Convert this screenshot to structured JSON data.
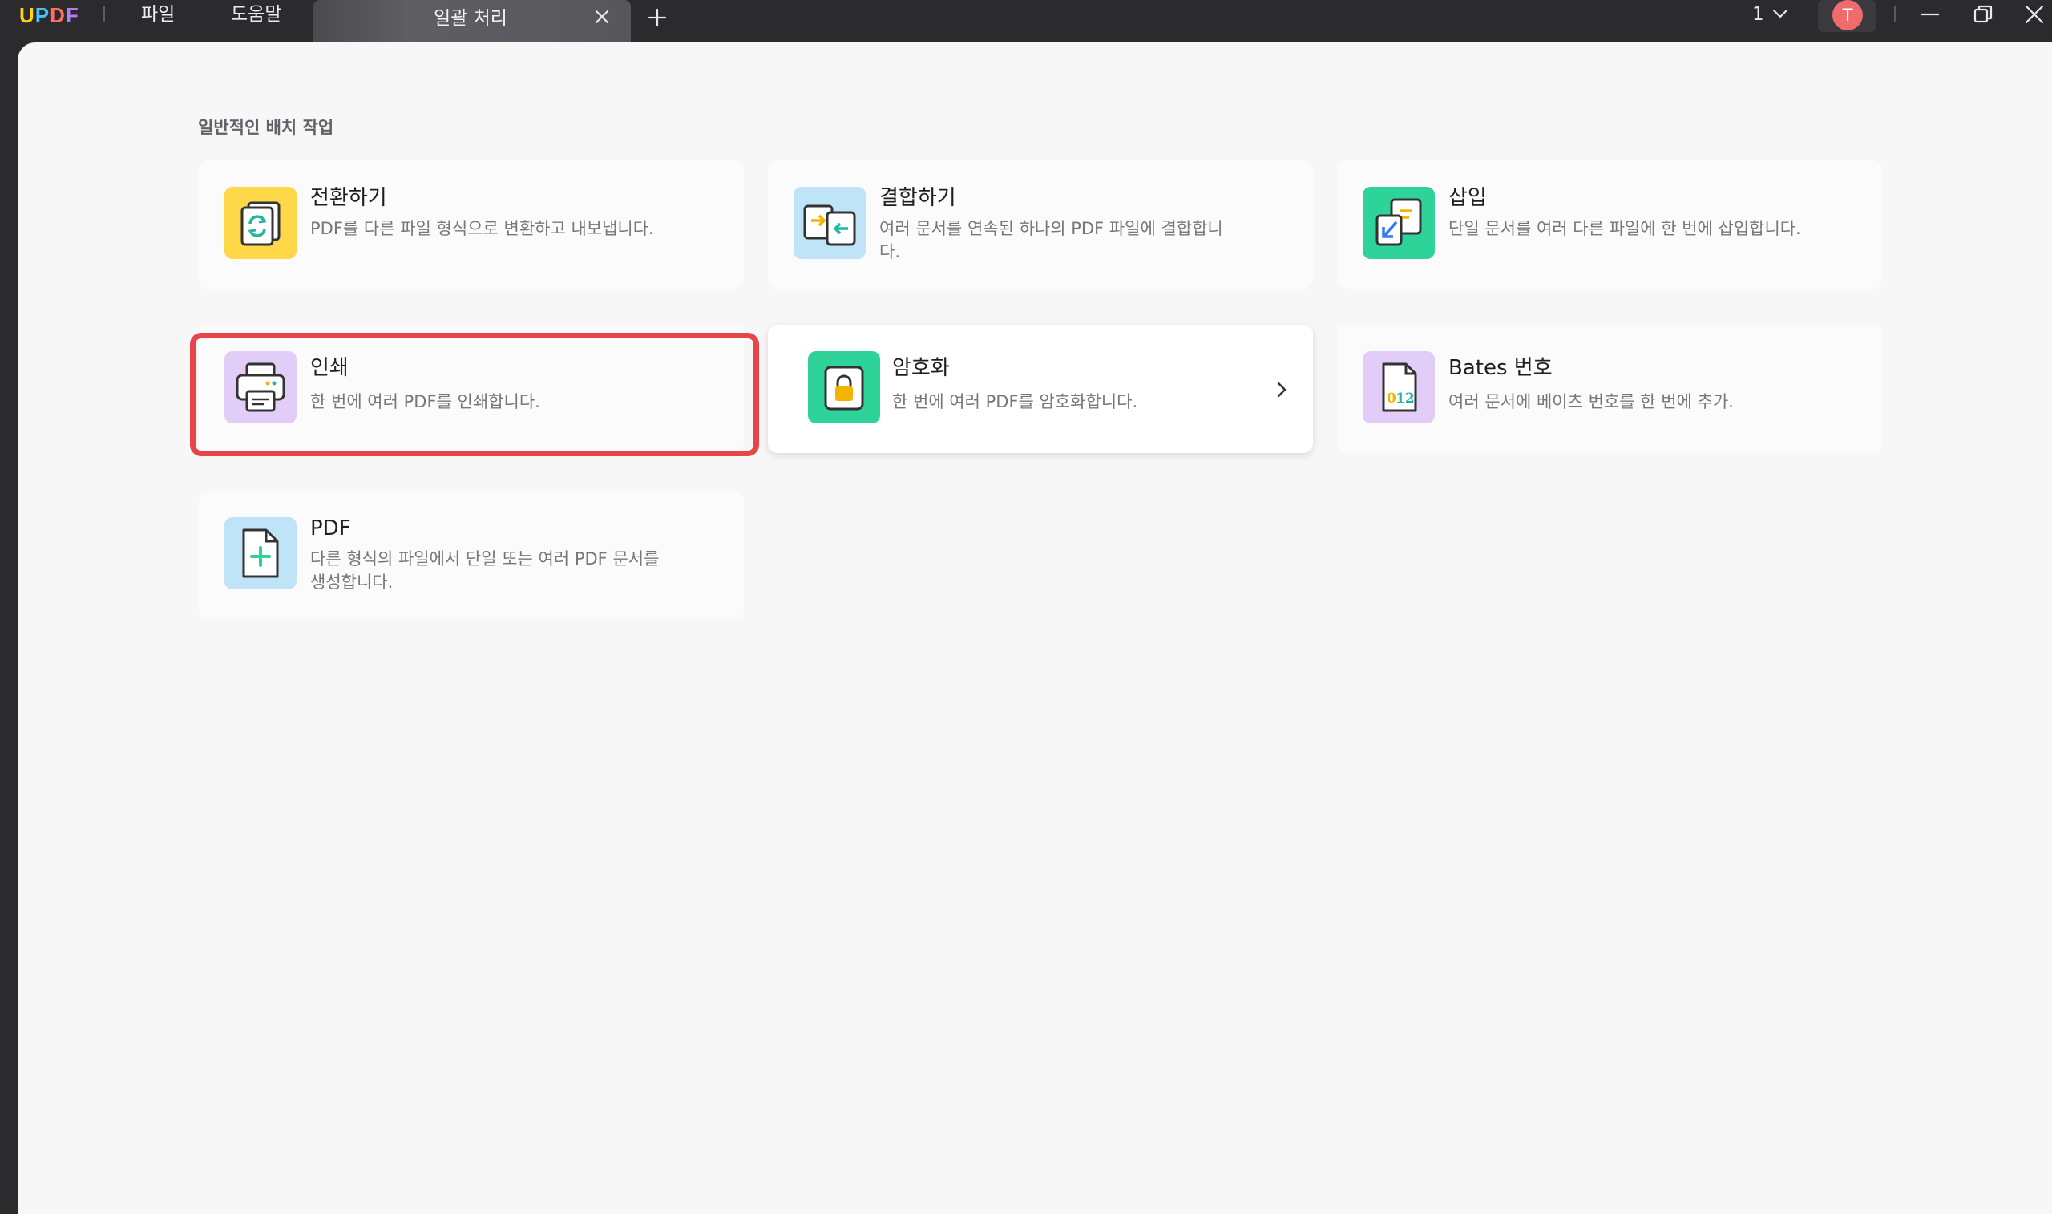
{
  "titlebar": {
    "logo": [
      "U",
      "P",
      "D",
      "F"
    ],
    "menu": [
      "파일",
      "도움말"
    ],
    "tab_title": "일괄 처리",
    "page_indicator": "1",
    "avatar_initial": "T"
  },
  "main": {
    "section_title": "일반적인 배치 작업",
    "cards": [
      {
        "title": "전환하기",
        "desc": "PDF를 다른 파일 형식으로 변환하고 내보냅니다."
      },
      {
        "title": "결합하기",
        "desc": "여러 문서를 연속된 하나의 PDF 파일에 결합합니다."
      },
      {
        "title": "삽입",
        "desc": "단일 문서를 여러 다른 파일에 한 번에 삽입합니다."
      },
      {
        "title": "인쇄",
        "desc": "한 번에 여러 PDF를 인쇄합니다."
      },
      {
        "title": "암호화",
        "desc": "한 번에 여러 PDF를 암호화합니다."
      },
      {
        "title": "Bates 번호",
        "desc": "여러 문서에 베이츠 번호를 한 번에 추가."
      },
      {
        "title": "PDF",
        "desc": "다른 형식의 파일에서 단일 또는 여러 PDF 문서를 생성합니다."
      }
    ]
  },
  "colors": {
    "highlight": "#e8454a",
    "convert_icon_bg": "#ffd84a",
    "combine_icon_bg": "#bfe4f7",
    "insert_icon_bg": "#2ed39a",
    "print_icon_bg": "#e1cdf7",
    "encrypt_icon_bg": "#2ed39a",
    "bates_icon_bg": "#e1cdf7",
    "create_icon_bg": "#bfe4f7"
  }
}
